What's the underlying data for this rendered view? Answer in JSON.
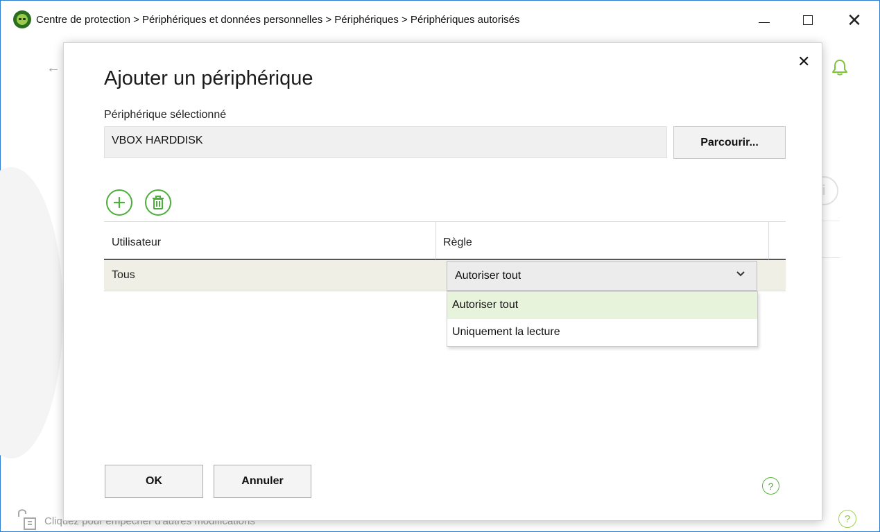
{
  "window": {
    "title": "Centre de protection > Périphériques et données personnelles > Périphériques > Périphériques autorisés",
    "controls": {
      "minimize": "",
      "maximize": "",
      "close": "✕"
    }
  },
  "background": {
    "back_icon": "←",
    "footer_text": "Cliquez pour empêcher d'autres modifications",
    "help_label": "?",
    "info_label": "i"
  },
  "dialog": {
    "title": "Ajouter un périphérique",
    "close_label": "✕",
    "device_label": "Périphérique sélectionné",
    "device_value": "VBOX HARDDISK",
    "browse_label": "Parcourir...",
    "table": {
      "columns": [
        "Utilisateur",
        "Règle"
      ],
      "rows": [
        {
          "user": "Tous",
          "rule": "Autoriser tout"
        }
      ]
    },
    "rule_options": [
      "Autoriser tout",
      "Uniquement la lecture"
    ],
    "ok_label": "OK",
    "cancel_label": "Annuler",
    "help_label": "?"
  },
  "colors": {
    "accent_green": "#4caf3a",
    "window_border": "#2b7fd3",
    "selected_option_bg": "#e8f3dc"
  },
  "icons": {
    "app": "drweb-spider-icon",
    "add": "plus-circle-icon",
    "delete": "trash-circle-icon",
    "bell": "bell-icon",
    "lock": "lock-icon"
  }
}
